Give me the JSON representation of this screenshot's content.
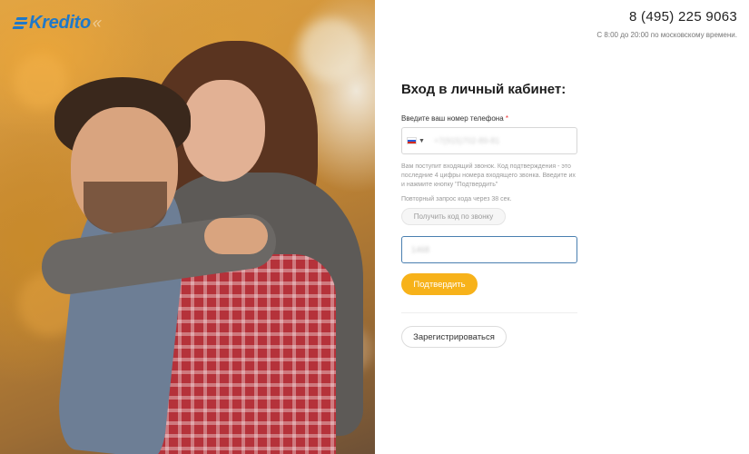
{
  "brand": {
    "name": "Kredito"
  },
  "contact": {
    "phone": "8 (495) 225 9063",
    "hours": "С 8:00 до 20:00 по московскому времени."
  },
  "form": {
    "title": "Вход в личный кабинет:",
    "phone_label": "Введите ваш номер телефона",
    "required_mark": "*",
    "country_flag": "ru-flag-icon",
    "phone_value": "+7(915)702-89-81",
    "hint": "Вам поступит входящий звонок. Код подтверждения - это последние 4 цифры номера входящего звонка. Введите их и нажмите кнопку \"Подтвердить\"",
    "repeat_text": "Повторный запрос кода через 38 сек.",
    "get_code_label": "Получить код по звонку",
    "code_value": "1468",
    "confirm_label": "Подтвердить",
    "register_label": "Зарегистрироваться"
  },
  "colors": {
    "brand_blue": "#1f78c8",
    "confirm_yellow": "#f7b21a",
    "input_focus_border": "#4a7fb0"
  }
}
